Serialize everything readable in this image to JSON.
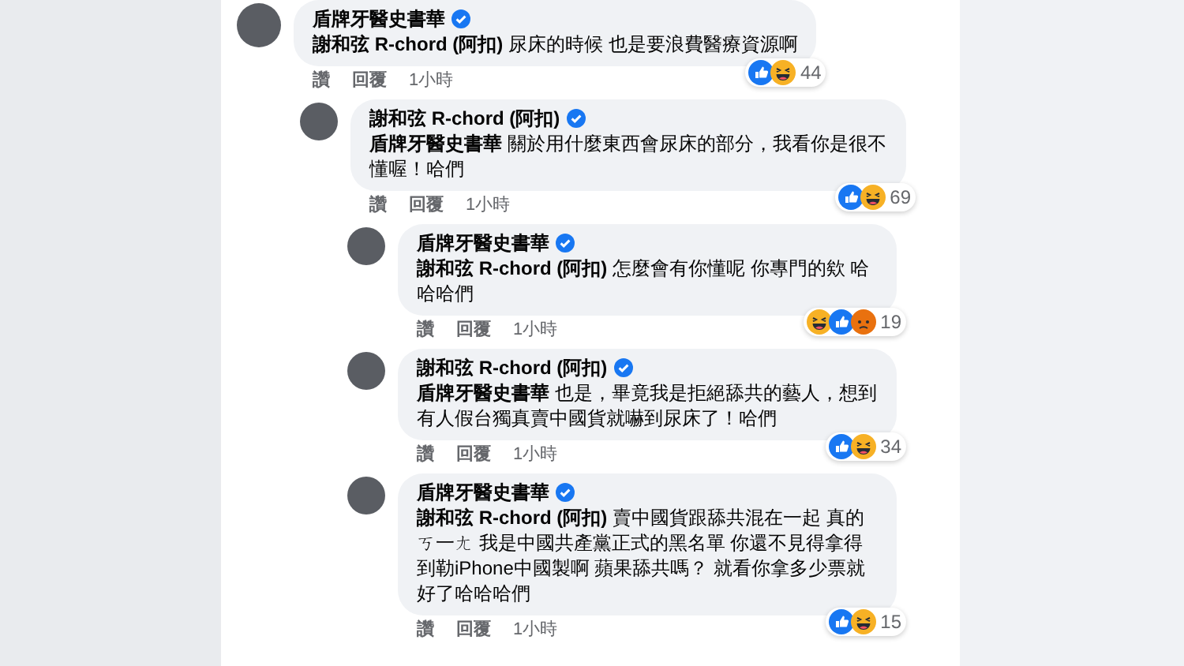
{
  "comments": [
    {
      "author": "盾牌牙醫史書華",
      "verified": true,
      "text": "**謝和弦 R-chord (阿扣)** 尿床的時候 也是要浪費醫療資源啊",
      "reactions": [
        {
          "kind": "like"
        },
        {
          "kind": "haha"
        }
      ],
      "reaction_count": "44",
      "actions": [
        "讚",
        "回覆"
      ],
      "time": "1小時",
      "children": [
        {
          "author": "謝和弦 R-chord (阿扣)",
          "verified": true,
          "text": "**盾牌牙醫史書華** 關於用什麼東西會尿床的部分，我看你是很不懂喔！哈們",
          "reactions": [
            {
              "kind": "like"
            },
            {
              "kind": "haha"
            }
          ],
          "reaction_count": "69",
          "actions": [
            "讚",
            "回覆"
          ],
          "time": "1小時",
          "children": [
            {
              "author": "盾牌牙醫史書華",
              "verified": true,
              "text": "**謝和弦 R-chord (阿扣)** 怎麼會有你懂呢 你專門的欸 哈哈哈們",
              "reactions": [
                {
                  "kind": "haha"
                },
                {
                  "kind": "like"
                },
                {
                  "kind": "angry"
                }
              ],
              "reaction_count": "19",
              "actions": [
                "讚",
                "回覆"
              ],
              "time": "1小時"
            },
            {
              "author": "謝和弦 R-chord (阿扣)",
              "verified": true,
              "text": "**盾牌牙醫史書華** 也是，畢竟我是拒絕舔共的藝人，想到有人假台獨真賣中國貨就嚇到尿床了！哈們",
              "reactions": [
                {
                  "kind": "like"
                },
                {
                  "kind": "haha"
                }
              ],
              "reaction_count": "34",
              "actions": [
                "讚",
                "回覆"
              ],
              "time": "1小時"
            },
            {
              "author": "盾牌牙醫史書華",
              "verified": true,
              "text": "**謝和弦 R-chord (阿扣)** 賣中國貨跟舔共混在一起 真的ㄎ一ㄤ 我是中國共產黨正式的黑名單 你還不見得拿得到勒iPhone中國製啊 蘋果舔共嗎？ 就看你拿多少票就好了哈哈哈們",
              "reactions": [
                {
                  "kind": "like"
                },
                {
                  "kind": "haha"
                }
              ],
              "reaction_count": "15",
              "actions": [
                "讚",
                "回覆"
              ],
              "time": "1小時"
            }
          ]
        }
      ]
    }
  ]
}
